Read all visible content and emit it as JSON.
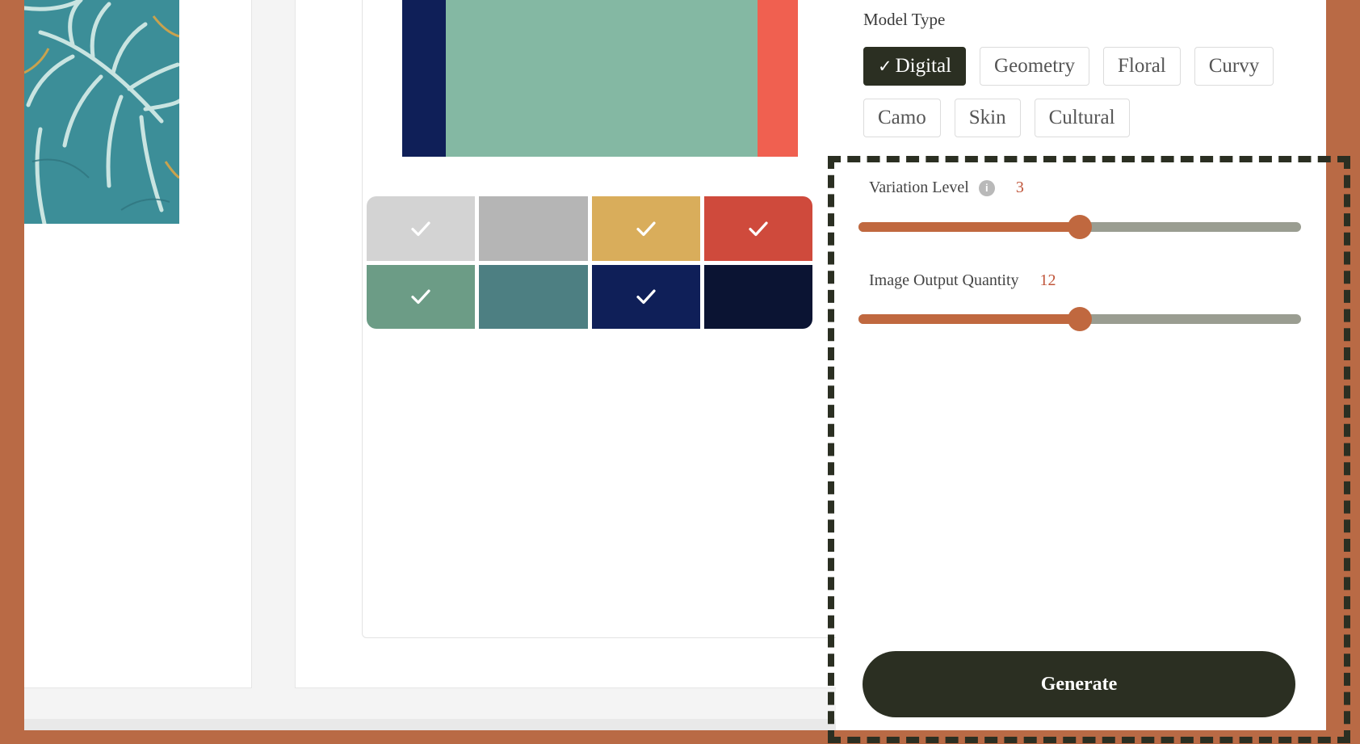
{
  "model_type": {
    "label": "Model Type",
    "chips": [
      {
        "label": "Digital",
        "selected": true
      },
      {
        "label": "Geometry",
        "selected": false
      },
      {
        "label": "Floral",
        "selected": false
      },
      {
        "label": "Curvy",
        "selected": false
      },
      {
        "label": "Camo",
        "selected": false
      },
      {
        "label": "Skin",
        "selected": false
      },
      {
        "label": "Cultural",
        "selected": false
      }
    ]
  },
  "variation_level": {
    "label": "Variation Level",
    "value": "3",
    "fraction": 0.5,
    "icon": "info-icon"
  },
  "image_output_quantity": {
    "label": "Image Output Quantity",
    "value": "12",
    "fraction": 0.5
  },
  "generate_label": "Generate",
  "color_swatches": [
    {
      "color": "#d3d3d3",
      "checked": true
    },
    {
      "color": "#b5b5b5",
      "checked": false
    },
    {
      "color": "#d9ad5b",
      "checked": true
    },
    {
      "color": "#cf4a3c",
      "checked": true
    },
    {
      "color": "#6c9c86",
      "checked": true
    },
    {
      "color": "#4d7f82",
      "checked": false
    },
    {
      "color": "#0f1f58",
      "checked": true
    },
    {
      "color": "#0b1433",
      "checked": false
    }
  ],
  "preview_colors": {
    "left": "#0f1f58",
    "middle": "#84b8a3",
    "right": "#f06050"
  },
  "colors": {
    "accent": "#c0683f",
    "dark": "#2b2f22",
    "frame": "#b96a45"
  }
}
